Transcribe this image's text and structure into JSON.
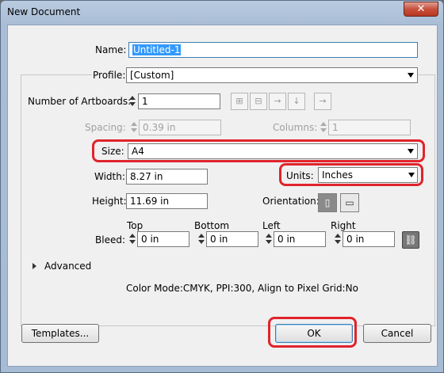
{
  "window": {
    "title": "New Document",
    "close_glyph": "✕"
  },
  "name": {
    "label": "Name:",
    "value": "Untitled-1"
  },
  "profile": {
    "label": "Profile:",
    "value": "[Custom]"
  },
  "artboards": {
    "label": "Number of Artboards:",
    "value": "1"
  },
  "spacing": {
    "label": "Spacing:",
    "value": "0.39 in"
  },
  "columns": {
    "label": "Columns:",
    "value": "1"
  },
  "size": {
    "label": "Size:",
    "value": "A4"
  },
  "width": {
    "label": "Width:",
    "value": "8.27 in"
  },
  "units": {
    "label": "Units:",
    "value": "Inches"
  },
  "height": {
    "label": "Height:",
    "value": "11.69 in"
  },
  "orientation": {
    "label": "Orientation:",
    "selected": "portrait"
  },
  "bleed": {
    "label": "Bleed:",
    "top": {
      "label": "Top",
      "value": "0 in"
    },
    "bottom": {
      "label": "Bottom",
      "value": "0 in"
    },
    "left": {
      "label": "Left",
      "value": "0 in"
    },
    "right": {
      "label": "Right",
      "value": "0 in"
    }
  },
  "advanced": {
    "label": "Advanced"
  },
  "info": {
    "text": "Color Mode:CMYK, PPI:300, Align to Pixel Grid:No"
  },
  "buttons": {
    "templates": "Templates...",
    "ok": "OK",
    "cancel": "Cancel"
  },
  "highlight_color": "#e0242c",
  "icons": {
    "artboard_layouts": [
      "grid-by-row-icon",
      "grid-by-column-icon",
      "arrange-by-row-icon",
      "arrange-by-column-icon"
    ],
    "layout_direction": "arrow-right-icon",
    "portrait": "portrait-orientation-icon",
    "landscape": "landscape-orientation-icon",
    "link": "link-bleed-icon"
  }
}
